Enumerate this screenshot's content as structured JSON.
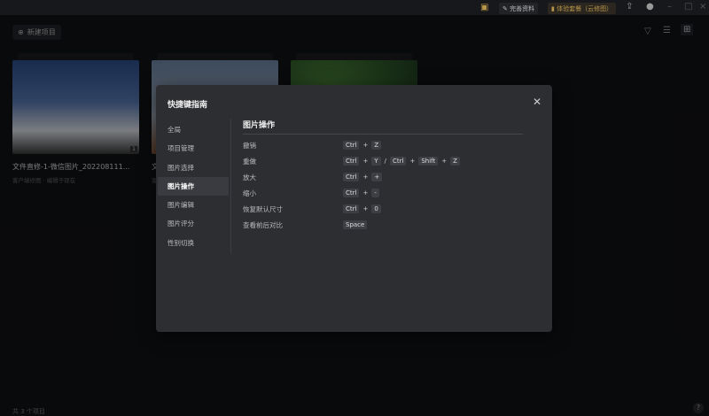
{
  "topbar": {
    "complete_profile": "完善资料",
    "trial": "体验套餐（云修图）"
  },
  "toolbar": {
    "new_project": "新建项目"
  },
  "cards": [
    {
      "title": "文件直修-1-微信图片_202208111...",
      "subtitle": "客户端修图 · 编辑于现在",
      "count": "1"
    },
    {
      "title": "文",
      "subtitle": "客"
    },
    {
      "title": "",
      "subtitle": ""
    }
  ],
  "footer": {
    "count": "共 3 个项目",
    "help": "?"
  },
  "modal": {
    "title": "快捷键指南",
    "nav": [
      "全局",
      "项目管理",
      "图片选择",
      "图片操作",
      "图片编辑",
      "图片评分",
      "性别切换"
    ],
    "active": "图片操作",
    "section_title": "图片操作",
    "shortcuts": [
      {
        "label": "撤销",
        "keys": [
          [
            "Ctrl",
            "Z"
          ]
        ]
      },
      {
        "label": "重做",
        "keys": [
          [
            "Ctrl",
            "Y"
          ],
          [
            "Ctrl",
            "Shift",
            "Z"
          ]
        ]
      },
      {
        "label": "放大",
        "keys": [
          [
            "Ctrl",
            "+"
          ]
        ]
      },
      {
        "label": "缩小",
        "keys": [
          [
            "Ctrl",
            "-"
          ]
        ]
      },
      {
        "label": "恢复默认尺寸",
        "keys": [
          [
            "Ctrl",
            "0"
          ]
        ]
      },
      {
        "label": "查看前后对比",
        "keys": [
          [
            "Space"
          ]
        ]
      }
    ]
  }
}
